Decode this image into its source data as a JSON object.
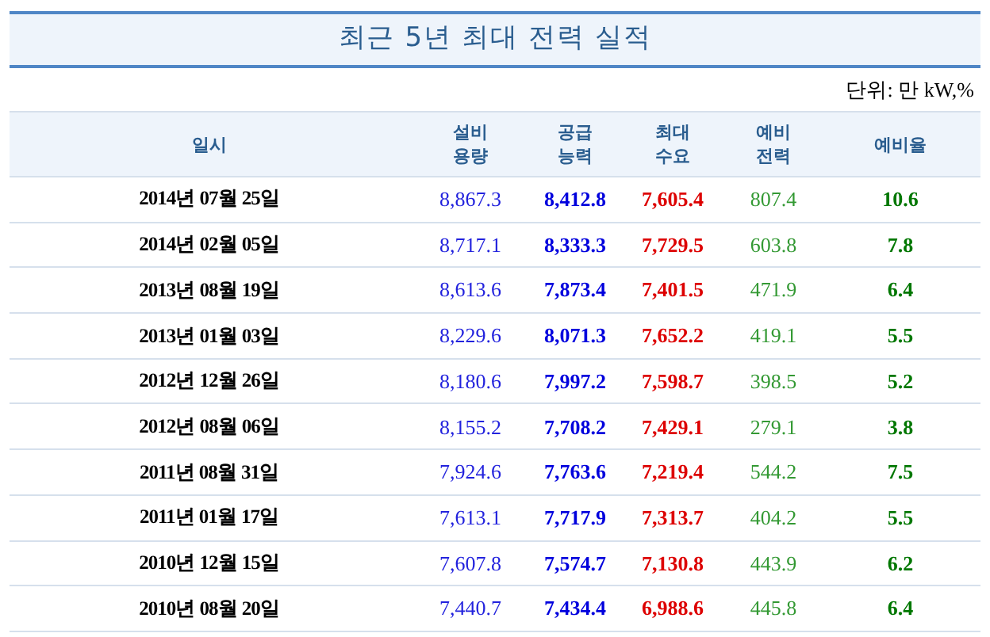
{
  "title": "최근 5년 최대 전력 실적",
  "unit": "단위: 만 kW,%",
  "columns": [
    {
      "label": [
        "일시"
      ],
      "color": "#000000",
      "bold": true
    },
    {
      "label": [
        "설비",
        "용량"
      ],
      "color": "#2222dd",
      "bold": false
    },
    {
      "label": [
        "공급",
        "능력"
      ],
      "color": "#0000dd",
      "bold": true
    },
    {
      "label": [
        "최대",
        "수요"
      ],
      "color": "#dd0000",
      "bold": true
    },
    {
      "label": [
        "예비",
        "전력"
      ],
      "color": "#339933",
      "bold": false
    },
    {
      "label": [
        "예비율"
      ],
      "color": "#007700",
      "bold": true
    }
  ],
  "rows": [
    [
      "2014년 07월 25일",
      "8,867.3",
      "8,412.8",
      "7,605.4",
      "807.4",
      "10.6"
    ],
    [
      "2014년 02월 05일",
      "8,717.1",
      "8,333.3",
      "7,729.5",
      "603.8",
      "7.8"
    ],
    [
      "2013년 08월 19일",
      "8,613.6",
      "7,873.4",
      "7,401.5",
      "471.9",
      "6.4"
    ],
    [
      "2013년 01월 03일",
      "8,229.6",
      "8,071.3",
      "7,652.2",
      "419.1",
      "5.5"
    ],
    [
      "2012년 12월 26일",
      "8,180.6",
      "7,997.2",
      "7,598.7",
      "398.5",
      "5.2"
    ],
    [
      "2012년 08월 06일",
      "8,155.2",
      "7,708.2",
      "7,429.1",
      "279.1",
      "3.8"
    ],
    [
      "2011년 08월 31일",
      "7,924.6",
      "7,763.6",
      "7,219.4",
      "544.2",
      "7.5"
    ],
    [
      "2011년 01월 17일",
      "7,613.1",
      "7,717.9",
      "7,313.7",
      "404.2",
      "5.5"
    ],
    [
      "2010년 12월 15일",
      "7,607.8",
      "7,574.7",
      "7,130.8",
      "443.9",
      "6.2"
    ],
    [
      "2010년 08월 20일",
      "7,440.7",
      "7,434.4",
      "6,988.6",
      "445.8",
      "6.4"
    ]
  ]
}
